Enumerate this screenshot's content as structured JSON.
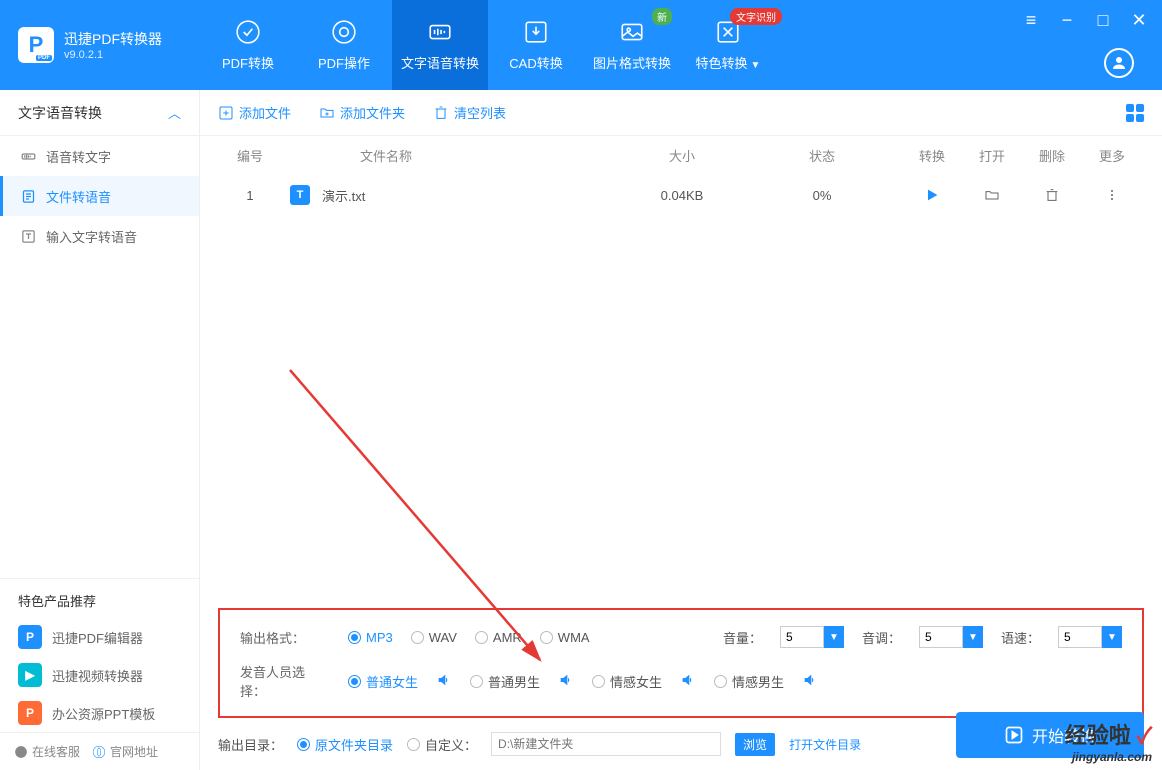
{
  "app": {
    "title": "迅捷PDF转换器",
    "version": "v9.0.2.1"
  },
  "tabs": [
    {
      "label": "PDF转换"
    },
    {
      "label": "PDF操作"
    },
    {
      "label": "文字语音转换"
    },
    {
      "label": "CAD转换"
    },
    {
      "label": "图片格式转换",
      "badge_new": "新"
    },
    {
      "label": "特色转换",
      "badge_hot": "文字识别"
    }
  ],
  "sidebar": {
    "header": "文字语音转换",
    "items": [
      "语音转文字",
      "文件转语音",
      "输入文字转语音"
    ]
  },
  "recommend": {
    "title": "特色产品推荐",
    "items": [
      "迅捷PDF编辑器",
      "迅捷视频转换器",
      "办公资源PPT模板"
    ]
  },
  "footer": {
    "service": "在线客服",
    "site": "官网地址"
  },
  "toolbar": {
    "add_file": "添加文件",
    "add_folder": "添加文件夹",
    "clear": "清空列表"
  },
  "table": {
    "head": {
      "num": "编号",
      "name": "文件名称",
      "size": "大小",
      "status": "状态",
      "convert": "转换",
      "open": "打开",
      "delete": "删除",
      "more": "更多"
    },
    "rows": [
      {
        "num": "1",
        "name": "演示.txt",
        "size": "0.04KB",
        "status": "0%"
      }
    ]
  },
  "options": {
    "format_label": "输出格式：",
    "formats": [
      "MP3",
      "WAV",
      "AMR",
      "WMA"
    ],
    "volume_label": "音量：",
    "volume": "5",
    "pitch_label": "音调：",
    "pitch": "5",
    "speed_label": "语速：",
    "speed": "5",
    "voice_label": "发音人员选择：",
    "voices": [
      "普通女生",
      "普通男生",
      "情感女生",
      "情感男生"
    ]
  },
  "output": {
    "label": "输出目录：",
    "source": "原文件夹目录",
    "custom": "自定义：",
    "placeholder": "D:\\新建文件夹",
    "browse": "浏览",
    "open_dir": "打开文件目录"
  },
  "start": "开始转换",
  "watermark": {
    "line1_a": "经验啦",
    "line1_b": "✓",
    "line2": "jingyanla.com"
  }
}
